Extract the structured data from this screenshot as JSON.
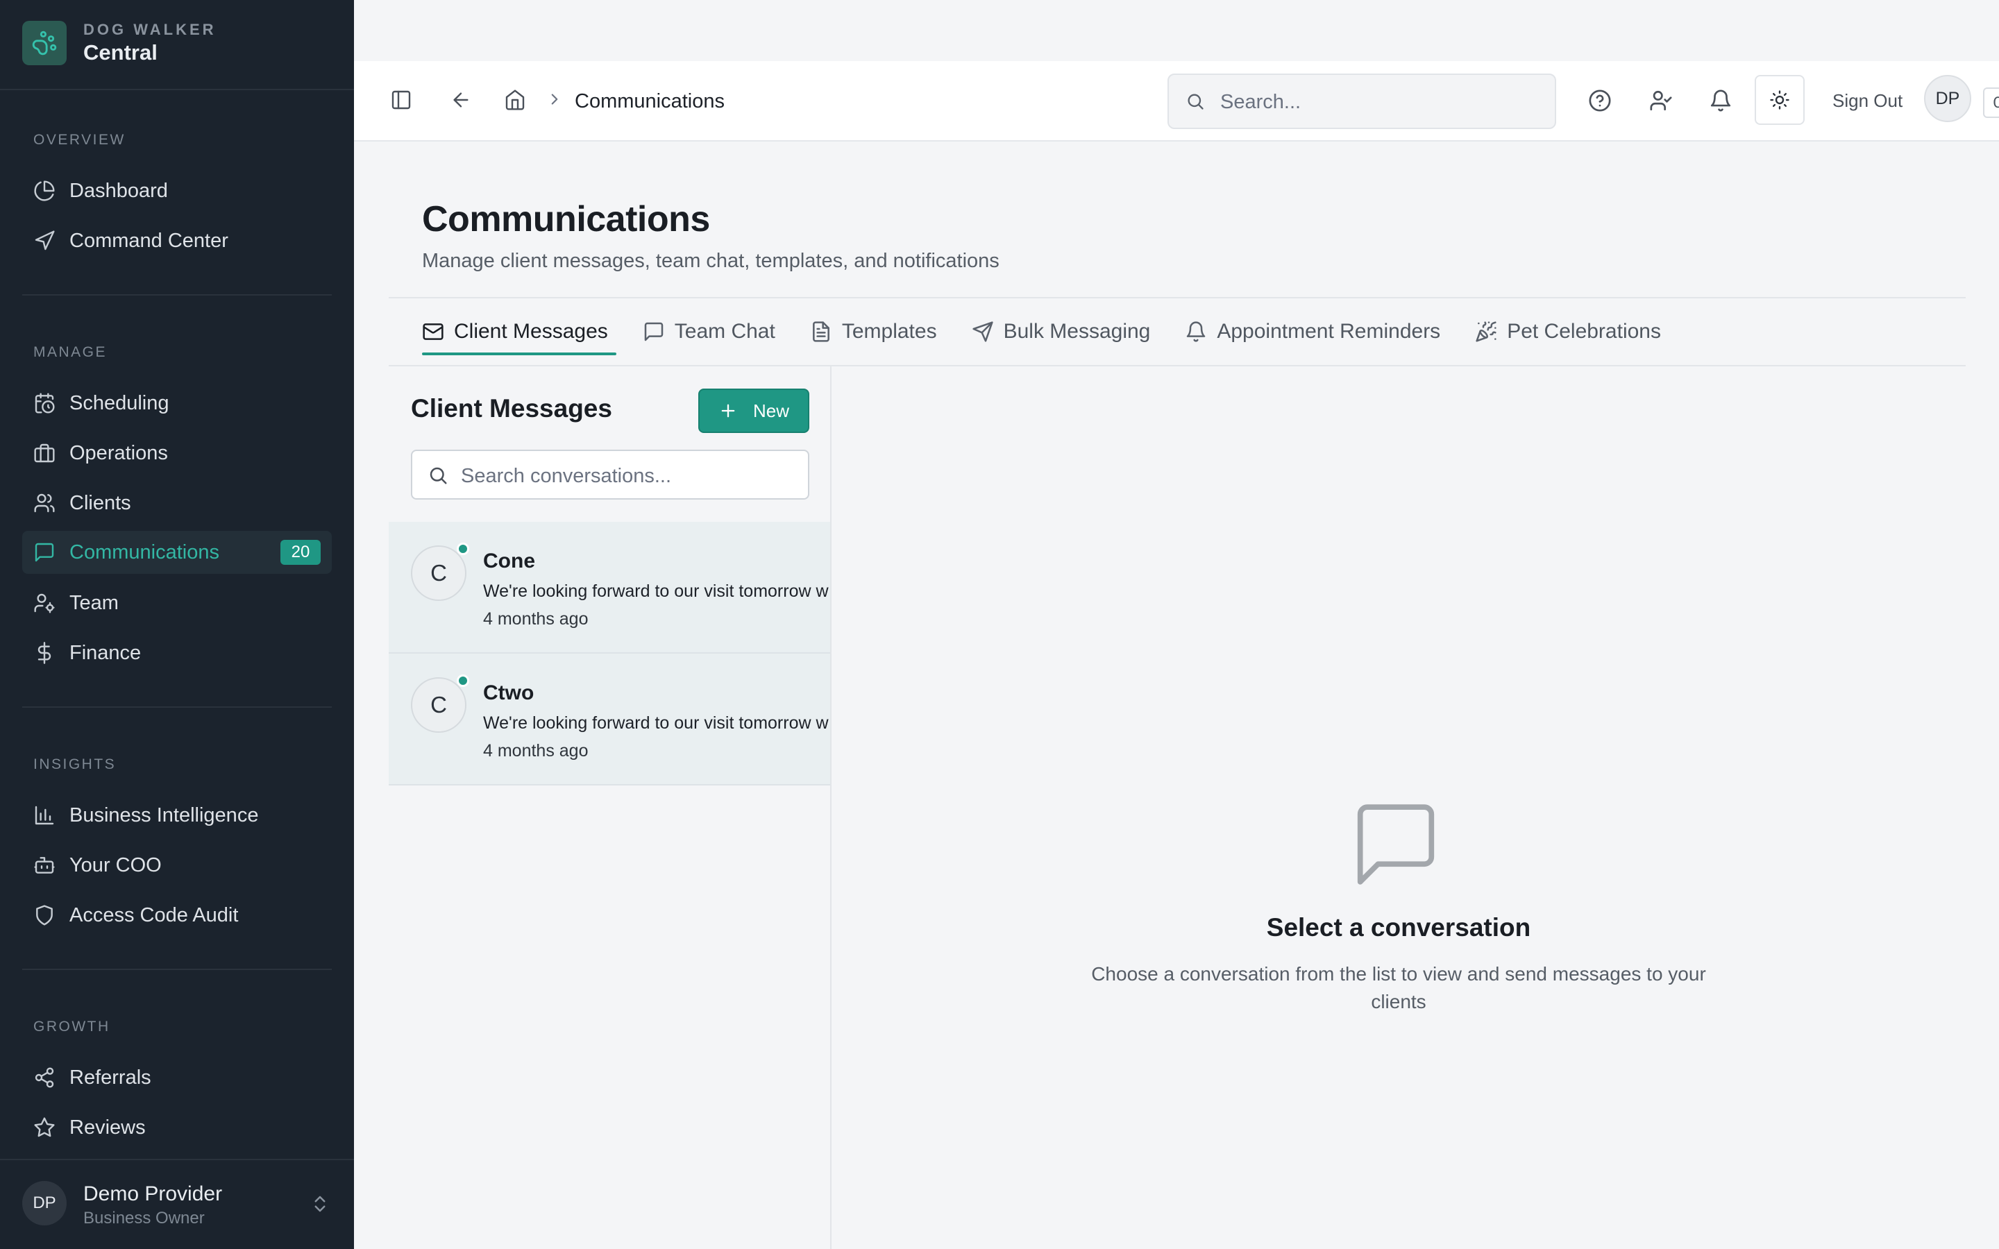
{
  "brand": {
    "sup": "DOG WALKER",
    "main": "Central",
    "logo_icon": "paw-icon"
  },
  "sidebar": {
    "sections": [
      {
        "label": "OVERVIEW"
      },
      {
        "label": "MANAGE"
      },
      {
        "label": "INSIGHTS"
      },
      {
        "label": "GROWTH"
      }
    ],
    "items": [
      {
        "label": "Dashboard",
        "icon": "pie-chart-icon"
      },
      {
        "label": "Command Center",
        "icon": "navigation-icon"
      },
      {
        "label": "Scheduling",
        "icon": "calendar-clock-icon"
      },
      {
        "label": "Operations",
        "icon": "briefcase-icon"
      },
      {
        "label": "Clients",
        "icon": "users-icon"
      },
      {
        "label": "Communications",
        "icon": "message-square-icon",
        "badge": "20",
        "active": true
      },
      {
        "label": "Team",
        "icon": "user-cog-icon"
      },
      {
        "label": "Finance",
        "icon": "dollar-icon"
      },
      {
        "label": "Business Intelligence",
        "icon": "bar-chart-icon"
      },
      {
        "label": "Your COO",
        "icon": "bot-icon"
      },
      {
        "label": "Access Code Audit",
        "icon": "shield-icon"
      },
      {
        "label": "Referrals",
        "icon": "share-icon"
      },
      {
        "label": "Reviews",
        "icon": "star-icon"
      }
    ],
    "user": {
      "initials": "DP",
      "name": "Demo Provider",
      "role": "Business Owner"
    }
  },
  "header": {
    "breadcrumb_current": "Communications",
    "search_placeholder": "Search...",
    "search_shortcut": "Ctrl+K",
    "sign_out": "Sign Out",
    "avatar_initials": "DP"
  },
  "page": {
    "title": "Communications",
    "subtitle": "Manage client messages, team chat, templates, and notifications"
  },
  "tabs": [
    {
      "label": "Client Messages",
      "icon": "mail-icon",
      "active": true
    },
    {
      "label": "Team Chat",
      "icon": "message-square-icon"
    },
    {
      "label": "Templates",
      "icon": "file-text-icon"
    },
    {
      "label": "Bulk Messaging",
      "icon": "send-icon"
    },
    {
      "label": "Appointment Reminders",
      "icon": "bell-icon"
    },
    {
      "label": "Pet Celebrations",
      "icon": "party-popper-icon"
    }
  ],
  "client_messages": {
    "title": "Client Messages",
    "new_button": "New",
    "search_placeholder": "Search conversations...",
    "conversations": [
      {
        "initial": "C",
        "name": "Cone",
        "preview": "We're looking forward to our visit tomorrow w",
        "time": "4 months ago",
        "online": true
      },
      {
        "initial": "C",
        "name": "Ctwo",
        "preview": "We're looking forward to our visit tomorrow w",
        "time": "4 months ago",
        "online": true
      }
    ]
  },
  "empty_state": {
    "icon": "message-square-icon",
    "title": "Select a conversation",
    "description": "Choose a conversation from the list to view and send messages to your clients"
  },
  "colors": {
    "sidebar_bg": "#1b232d",
    "accent": "#1f9784",
    "accent_text": "#33b7a4",
    "page_bg": "#f4f5f7"
  }
}
